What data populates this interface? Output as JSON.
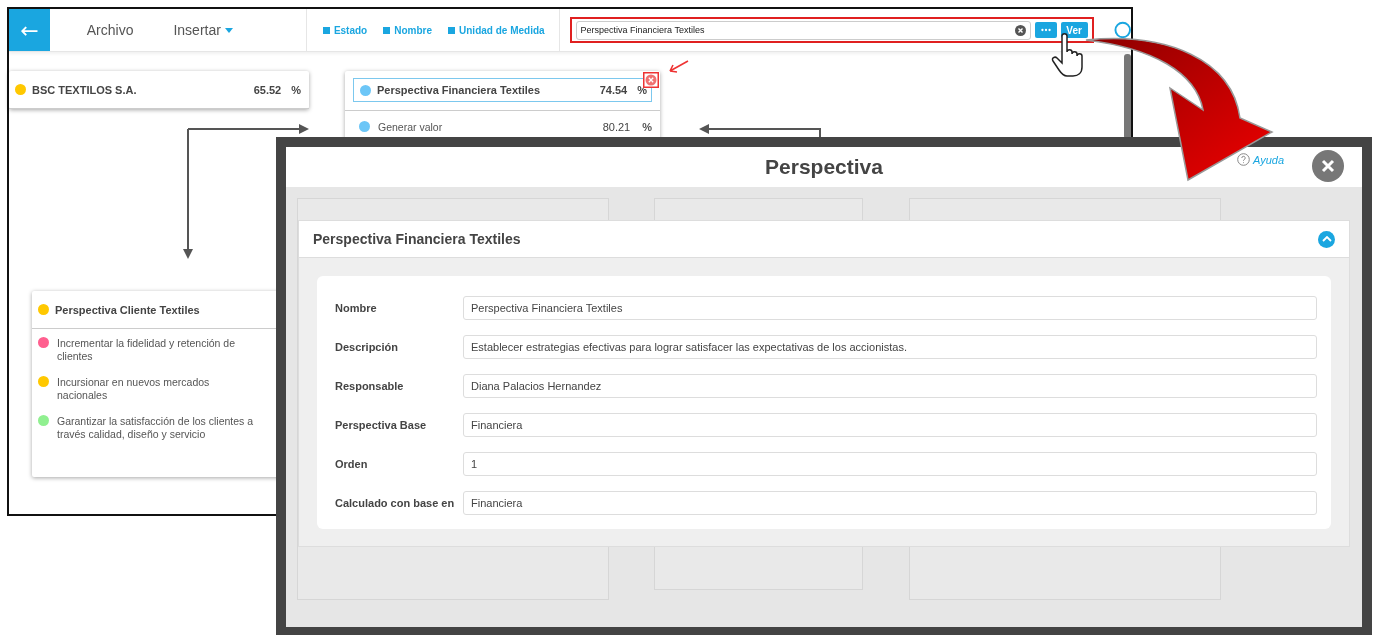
{
  "back_window": {
    "back_button": "←",
    "menu": [
      {
        "label": "Archivo",
        "dropdown": false
      },
      {
        "label": "Insertar",
        "dropdown": true
      }
    ],
    "legend": [
      {
        "label": "Estado",
        "checked": true
      },
      {
        "label": "Nombre",
        "checked": true
      },
      {
        "label": "Unidad de Medida",
        "checked": true
      }
    ],
    "search": {
      "value": "Perspectiva Financiera Textiles",
      "view_button": "Ver"
    },
    "cards": [
      {
        "title": "BSC TEXTILOS S.A.",
        "value": "65.52",
        "unit": "%",
        "color": "#ffc800",
        "selected": false
      },
      {
        "title": "Perspectiva Financiera Textiles",
        "value": "74.54",
        "unit": "%",
        "color": "#6cc6f7",
        "selected": true,
        "items": [
          {
            "label": "Generar valor",
            "value": "80.21",
            "unit": "%",
            "color": "#6cc6f7"
          }
        ]
      },
      {
        "title": "Perspectiva Cliente Textiles",
        "color": "#ffc800",
        "selected": false,
        "items": [
          {
            "label": "Incrementar la fidelidad y retención de clientes",
            "color": "#ff5f8f"
          },
          {
            "label": "Incursionar en nuevos mercados nacionales",
            "color": "#ffc800"
          },
          {
            "label": "Garantizar la satisfacción de los clientes a través calidad, diseño y servicio",
            "color": "#90f090"
          }
        ]
      }
    ]
  },
  "dialog": {
    "title": "Perspectiva",
    "help": "Ayuda",
    "section": {
      "title": "Perspectiva Financiera Textiles",
      "expanded": true,
      "fields": [
        {
          "label": "Nombre",
          "value": "Perspectiva Financiera Textiles"
        },
        {
          "label": "Descripción",
          "value": "Establecer estrategias efectivas para lograr satisfacer las expectativas de los accionistas."
        },
        {
          "label": "Responsable",
          "value": "Diana Palacios Hernandez"
        },
        {
          "label": "Perspectiva Base",
          "value": "Financiera"
        },
        {
          "label": "Orden",
          "value": "1"
        },
        {
          "label": "Calculado con base en",
          "value": "Financiera"
        }
      ]
    }
  }
}
